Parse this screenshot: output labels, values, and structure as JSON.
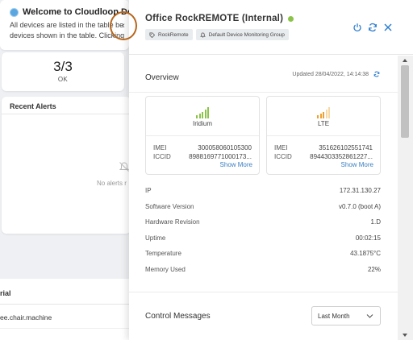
{
  "background": {
    "welcome_title": "Welcome to Cloudloop Devi",
    "welcome_line1": "All devices are listed in the table be",
    "welcome_line2": "devices shown in the table. Clicking",
    "ok_count": "3/3",
    "ok_label": "OK",
    "alerts_title": "Recent Alerts",
    "alerts_empty": "No alerts r",
    "table_header": "rial",
    "table_row1": "ee.chair.machine"
  },
  "drawer": {
    "title": "Office RockREMOTE (Internal)",
    "status_color": "#8bc34a",
    "tags": [
      {
        "label": "RockRemote",
        "icon": "tag-icon"
      },
      {
        "label": "Default Device Monitoring Group",
        "icon": "bell-icon"
      }
    ],
    "overview_title": "Overview",
    "updated": "Updated 28/04/2022, 14:14:38",
    "cards": [
      {
        "network": "Iridium",
        "signal_color": "#8bc34a",
        "imei_label": "IMEI",
        "imei": "300058060105300",
        "iccid_label": "ICCID",
        "iccid": "8988169771000173...",
        "more": "Show More"
      },
      {
        "network": "LTE",
        "signal_color": "#f0a030",
        "imei_label": "IMEI",
        "imei": "351626102551741",
        "iccid_label": "ICCID",
        "iccid": "894430335286122​7...",
        "more": "Show More"
      }
    ],
    "properties": [
      {
        "label": "IP",
        "value": "172.31.130.27"
      },
      {
        "label": "Software Version",
        "value": "v0.7.0 (boot A)"
      },
      {
        "label": "Hardware Revision",
        "value": "1.D"
      },
      {
        "label": "Uptime",
        "value": "00:02:15"
      },
      {
        "label": "Temperature",
        "value": "43.1875°C"
      },
      {
        "label": "Memory Used",
        "value": "22%"
      }
    ],
    "control_title": "Control Messages",
    "control_period": "Last Month"
  }
}
